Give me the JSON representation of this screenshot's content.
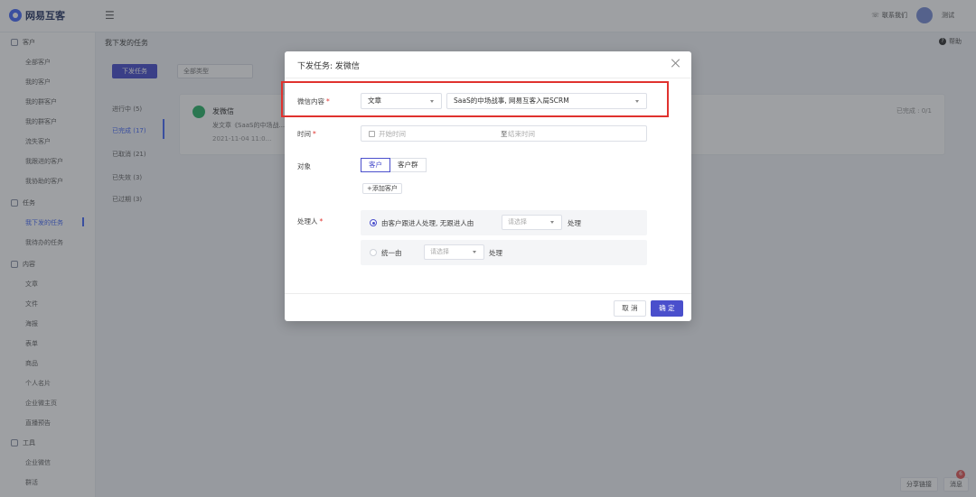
{
  "app": {
    "logo": "网易互客"
  },
  "header": {
    "link": "联系我们",
    "user": "测试"
  },
  "sidebar": {
    "groups": [
      {
        "label": "客户",
        "items": [
          "全部客户",
          "我的客户",
          "我的群客户",
          "我的群客户",
          "流失客户",
          "我跟进的客户",
          "我协助的客户"
        ]
      },
      {
        "label": "任务",
        "items": [
          "我下发的任务",
          "我待办的任务"
        ]
      },
      {
        "label": "内容",
        "items": [
          "文章",
          "文件",
          "海报",
          "表单",
          "商品",
          "个人名片",
          "企业微主页",
          "直播预告"
        ]
      },
      {
        "label": "工具",
        "items": [
          "企业微信",
          "群活"
        ]
      }
    ],
    "active_item": "我下发的任务"
  },
  "page": {
    "breadcrumb": "我下发的任务",
    "help": "帮助",
    "new_button": "下发任务",
    "filter_placeholder": "全部类型",
    "status_items": [
      "进行中 (5)",
      "已完成 (17)",
      "已取消 (21)",
      "已失效 (3)",
      "已过期 (3)"
    ],
    "task_card": {
      "title": "发微信",
      "subtitle": "发文章《SaaS的中场战...",
      "time": "2021-11-04 11:0...",
      "right": "已完成 : 0/1"
    },
    "bottom_chips": [
      "分享链接",
      "消息"
    ],
    "badge": "6"
  },
  "modal": {
    "title": "下发任务: 发微信",
    "content_label": "微信内容",
    "content_type": "文章",
    "content_value": "SaaS的中场战事, 网易互客入局SCRM",
    "time_label": "时间",
    "time_start_placeholder": "开始时间",
    "time_separator": "至",
    "time_end_placeholder": "结束时间",
    "target_label": "对象",
    "target_tabs": [
      "客户",
      "客户群"
    ],
    "add_customer": "+添加客户",
    "handler_label": "处理人",
    "handler_option1_text": "由客户跟进人处理, 无跟进人由",
    "handler_option2_text": "统一由",
    "select_placeholder": "请选择",
    "handler_suffix": "处理",
    "required_mark": "*",
    "cancel": "取 消",
    "confirm": "确 定"
  }
}
